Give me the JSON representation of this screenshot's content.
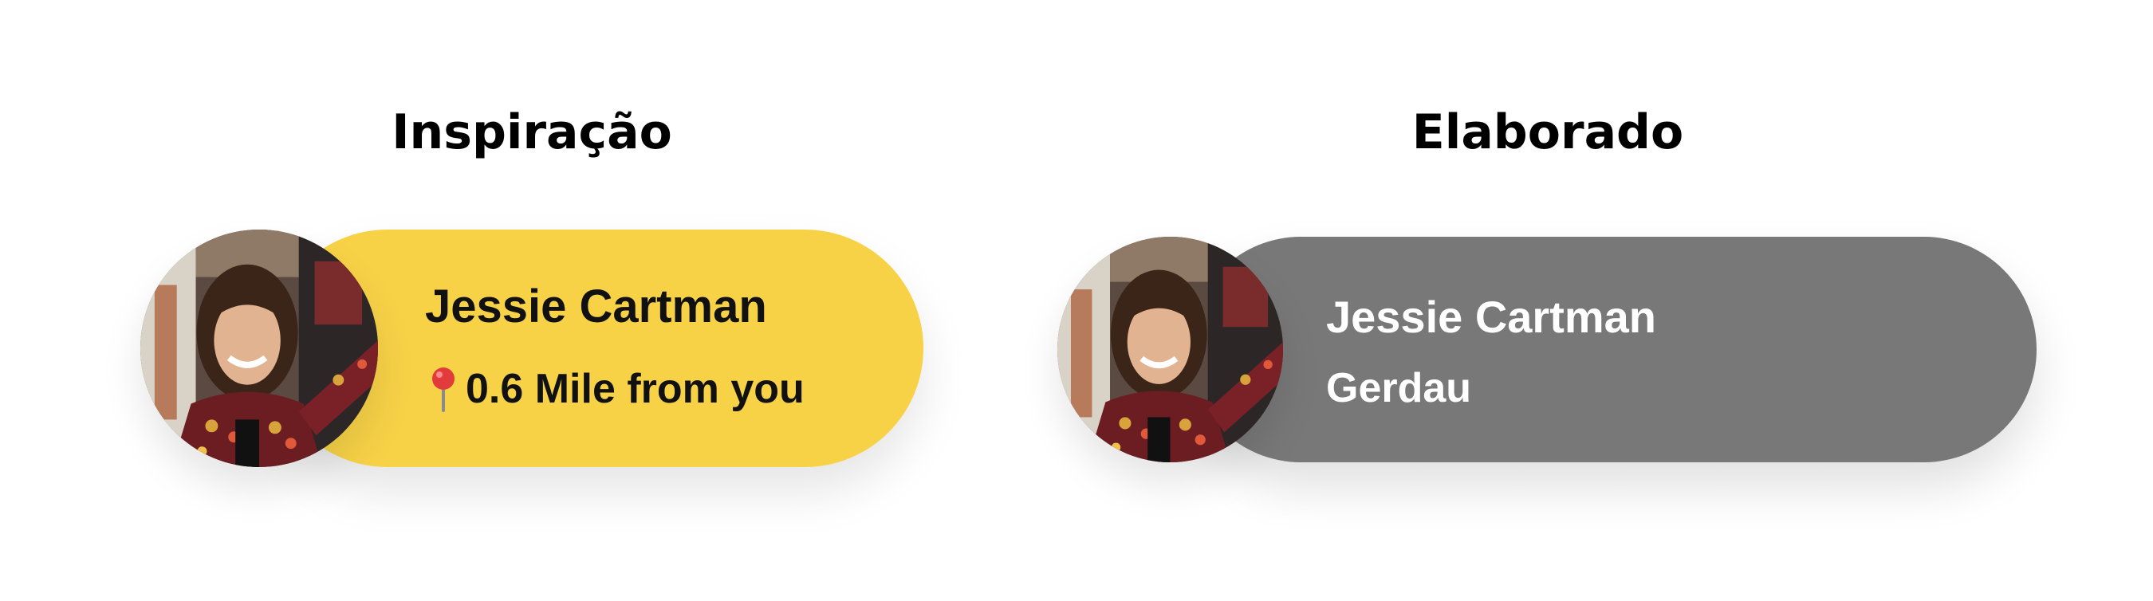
{
  "panels": {
    "left": {
      "title": "Inspiração",
      "card": {
        "name": "Jessie Cartman",
        "subtitle": "0.6 Mile from you",
        "subtitle_icon": "pin-icon",
        "background": "#f7d247",
        "text_color": "#111111"
      }
    },
    "right": {
      "title": "Elaborado",
      "card": {
        "name": "Jessie Cartman",
        "subtitle": "Gerdau",
        "background": "#787878",
        "text_color": "#ffffff"
      }
    }
  }
}
